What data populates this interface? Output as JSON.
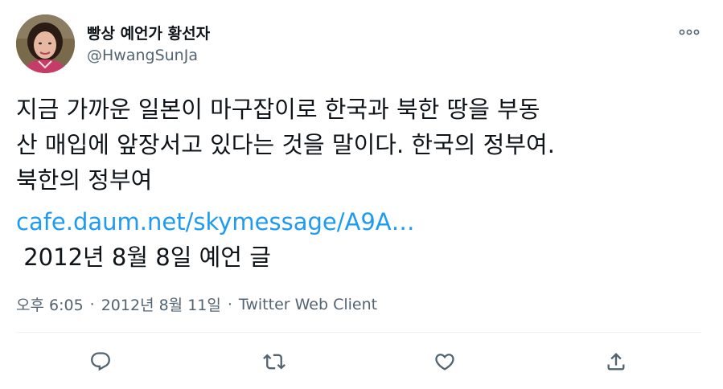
{
  "user": {
    "display_name": "빵상 예언가 황선자",
    "handle": "@HwangSunJa",
    "avatar_icon": "profile-photo"
  },
  "tweet": {
    "text": "지금 가까운 일본이 마구잡이로 한국과 북한 땅을 부동\n산 매입에 앞장서고 있다는 것을 말이다. 한국의 정부여.\n북한의 정부여",
    "link_text": "cafe.daum.net/skymessage/A9A…",
    "extra_line": " 2012년 8월 8일 예언 글",
    "time": "오후 6:05",
    "date": "2012년 8월 11일",
    "separator": "·",
    "source": "Twitter Web Client"
  },
  "actions": {
    "reply_icon": "reply-icon",
    "retweet_icon": "retweet-icon",
    "like_icon": "heart-icon",
    "share_icon": "share-icon",
    "more_icon": "more-icon"
  },
  "colors": {
    "text": "#0f1419",
    "secondary": "#536471",
    "link": "#1d9bf0",
    "divider": "#eff3f4"
  }
}
